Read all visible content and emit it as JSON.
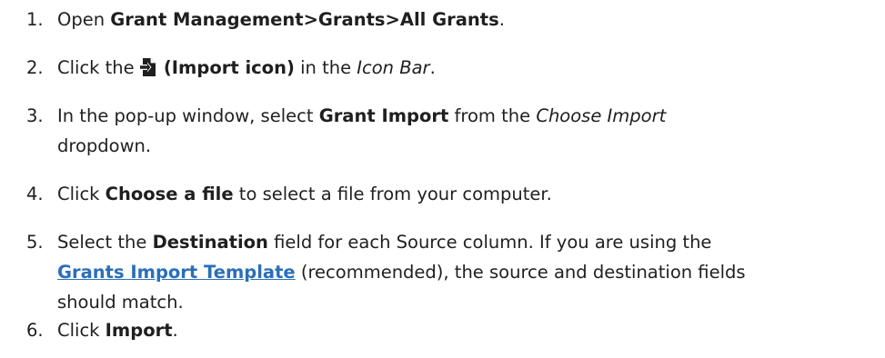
{
  "steps": [
    {
      "number": "1.",
      "text_before": "Open ",
      "bold": "Grant Management>Grants>All Grants",
      "text_after": "."
    },
    {
      "number": "2.",
      "text_before": "Click the ",
      "bold": "(Import icon)",
      "text_middle": " in the ",
      "italic": "Icon Bar",
      "text_after": ".",
      "icon": "import-icon"
    },
    {
      "number": "3.",
      "text_before": "In the pop-up window, select ",
      "bold": "Grant Import",
      "text_middle": " from the ",
      "italic": "Choose Import",
      "text_line2": "dropdown."
    },
    {
      "number": "4.",
      "text_before": "Click ",
      "bold": "Choose a file",
      "text_after": " to select a file from your computer."
    },
    {
      "number": "5.",
      "text_before": "Select the ",
      "bold": "Destination",
      "text_after": " field for each Source column. If you are using the",
      "link": "Grants Import Template",
      "text_after_link": " (recommended), the source and destination fields",
      "text_line3": "should match."
    },
    {
      "number": "6.",
      "text_before": "Click ",
      "bold": "Import",
      "text_after": "."
    }
  ],
  "colors": {
    "text": "#1f1f1f",
    "link": "#2a6fb8"
  }
}
